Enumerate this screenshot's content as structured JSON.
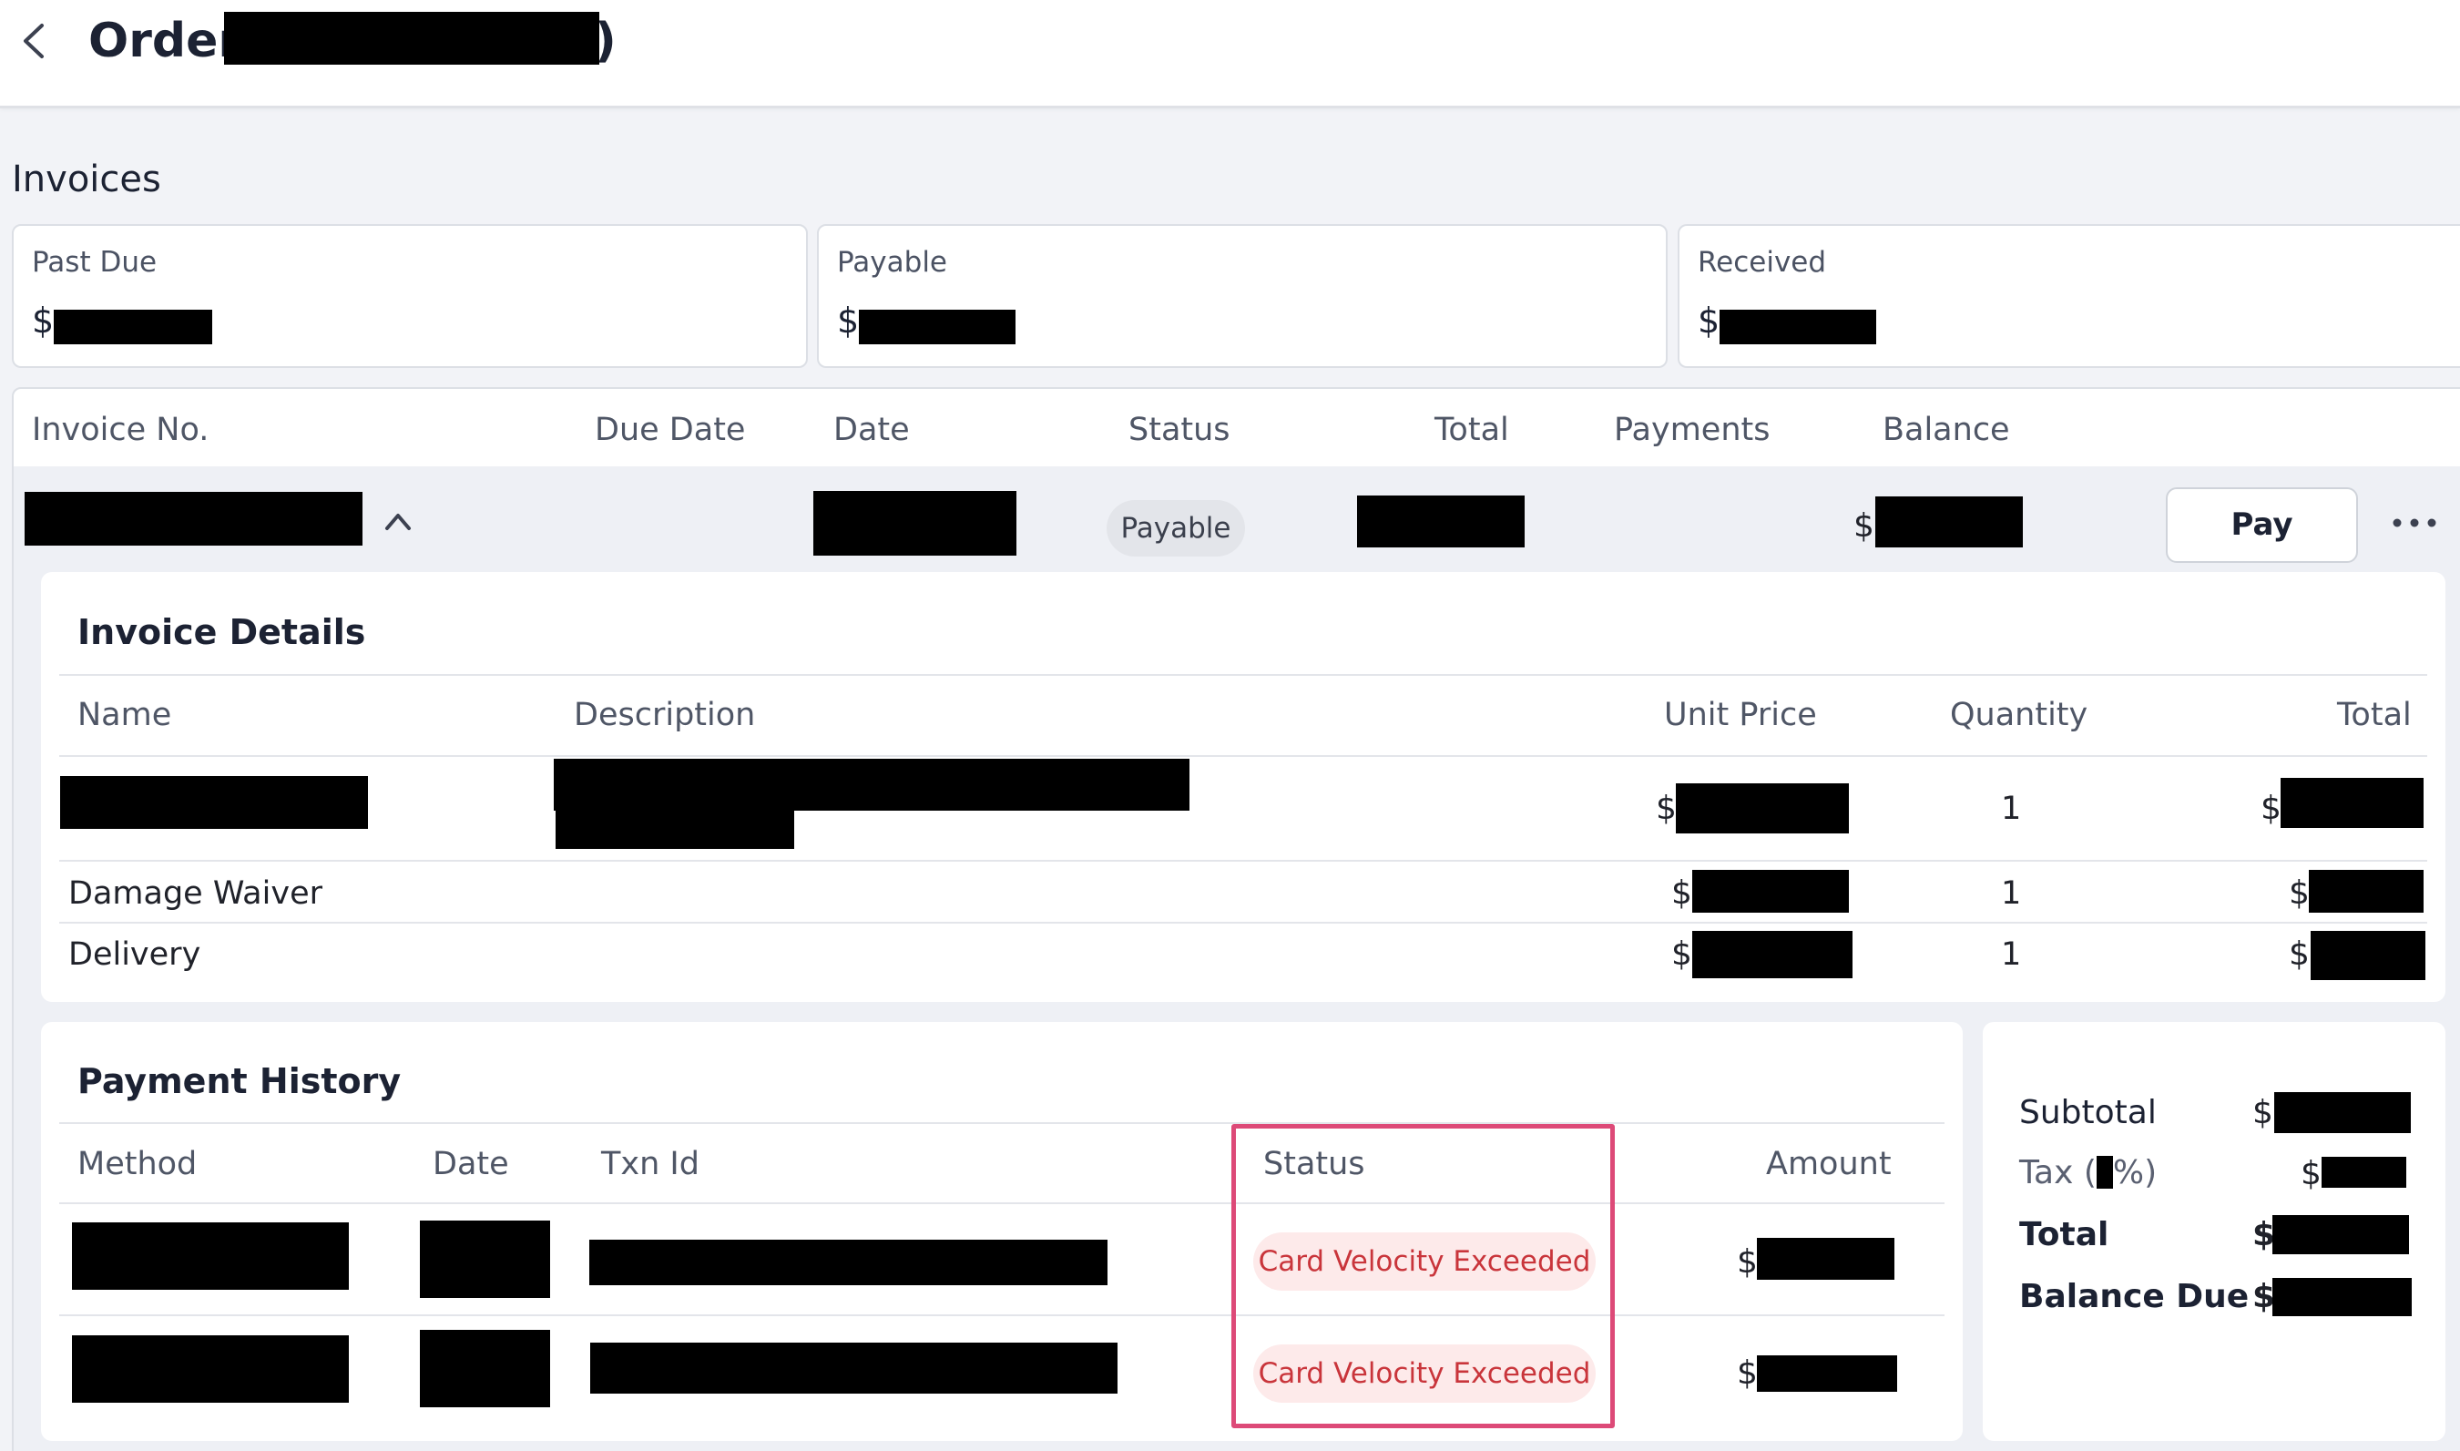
{
  "header": {
    "title_prefix": "Order(",
    "title_suffix": ")",
    "back_icon": "chevron-left-icon"
  },
  "invoices": {
    "section_title": "Invoices",
    "summary": [
      {
        "label": "Past Due",
        "currency": "$"
      },
      {
        "label": "Payable",
        "currency": "$"
      },
      {
        "label": "Received",
        "currency": "$"
      }
    ],
    "columns": [
      "Invoice No.",
      "Due Date",
      "Date",
      "Status",
      "Total",
      "Payments",
      "Balance"
    ],
    "row": {
      "status": "Payable",
      "balance_currency": "$",
      "pay_label": "Pay",
      "expand_icon": "chevron-up-icon",
      "more_icon": "more-horizontal-icon"
    }
  },
  "invoice_details": {
    "title": "Invoice Details",
    "columns": [
      "Name",
      "Description",
      "Unit Price",
      "Quantity",
      "Total"
    ],
    "items": [
      {
        "name": "",
        "unit_price_currency": "$",
        "quantity": "1",
        "total_currency": "$"
      },
      {
        "name": "Damage Waiver",
        "unit_price_currency": "$",
        "quantity": "1",
        "total_currency": "$"
      },
      {
        "name": "Delivery",
        "unit_price_currency": "$",
        "quantity": "1",
        "total_currency": "$"
      }
    ]
  },
  "payment_history": {
    "title": "Payment History",
    "columns": [
      "Method",
      "Date",
      "Txn Id",
      "Status",
      "Amount"
    ],
    "rows": [
      {
        "status": "Card Velocity Exceeded",
        "amount_currency": "$"
      },
      {
        "status": "Card Velocity Exceeded",
        "amount_currency": "$"
      }
    ]
  },
  "totals": {
    "subtotal_label": "Subtotal",
    "tax_label_prefix": "Tax (",
    "tax_label_suffix": "%)",
    "total_label": "Total",
    "balance_due_label": "Balance Due",
    "currency": "$"
  },
  "colors": {
    "accent_highlight": "#dd4a78",
    "error_text": "#c9353b",
    "error_bg": "#fdeaea",
    "page_bg": "#f2f3f7"
  }
}
